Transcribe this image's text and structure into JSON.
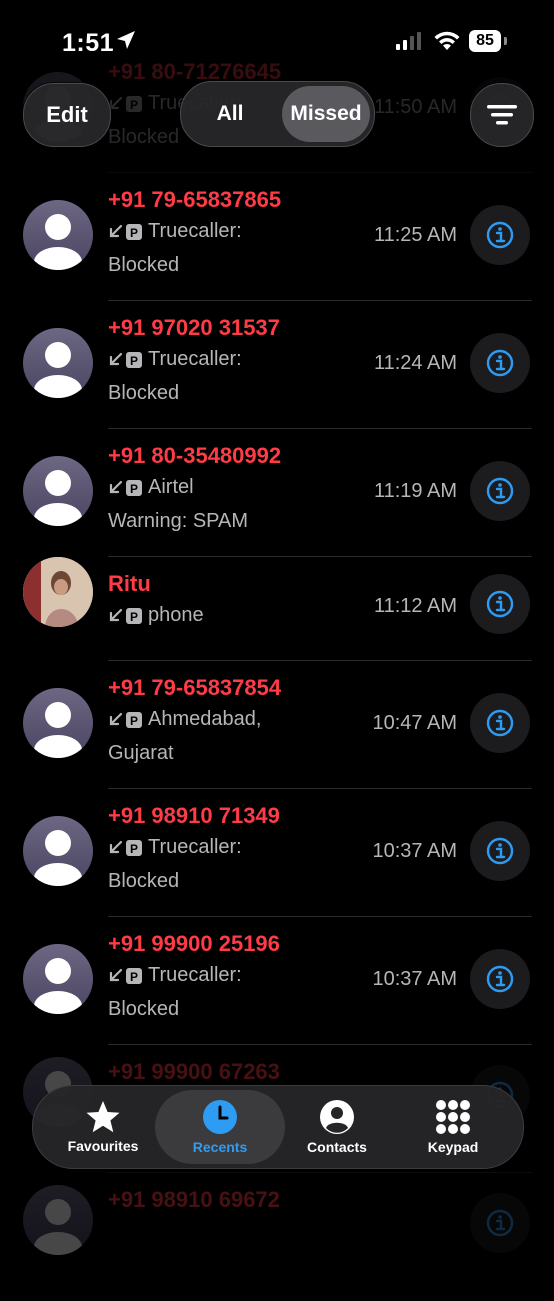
{
  "status_bar": {
    "time": "1:51",
    "battery": "85"
  },
  "toolbar": {
    "edit_label": "Edit",
    "filter_all": "All",
    "filter_missed": "Missed"
  },
  "calls": [
    {
      "name": "+91 80-71276645",
      "line1": "Truecaller:",
      "line2": "Blocked",
      "time": "11:50 AM",
      "photo": false
    },
    {
      "name": "+91 79-65837865",
      "line1": "Truecaller:",
      "line2": "Blocked",
      "time": "11:25 AM",
      "photo": false
    },
    {
      "name": "+91 97020 31537",
      "line1": "Truecaller:",
      "line2": "Blocked",
      "time": "11:24 AM",
      "photo": false
    },
    {
      "name": "+91 80-35480992",
      "line1": "Airtel",
      "line2": "Warning: SPAM",
      "time": "11:19 AM",
      "photo": false
    },
    {
      "name": "Ritu",
      "line1": "phone",
      "line2": "",
      "time": "11:12 AM",
      "photo": true
    },
    {
      "name": "+91 79-65837854",
      "line1": "Ahmedabad,",
      "line2": "Gujarat",
      "time": "10:47 AM",
      "photo": false
    },
    {
      "name": "+91 98910 71349",
      "line1": "Truecaller:",
      "line2": "Blocked",
      "time": "10:37 AM",
      "photo": false
    },
    {
      "name": "+91 99900 25196",
      "line1": "Truecaller:",
      "line2": "Blocked",
      "time": "10:37 AM",
      "photo": false
    },
    {
      "name": "+91 99900 67263",
      "line1": "",
      "line2": "",
      "time": "",
      "photo": false
    },
    {
      "name": "+91 98910 69672",
      "line1": "",
      "line2": "",
      "time": "",
      "photo": false
    }
  ],
  "tabs": [
    {
      "label": "Favourites",
      "icon": "star-icon",
      "active": false
    },
    {
      "label": "Recents",
      "icon": "clock-icon",
      "active": true
    },
    {
      "label": "Contacts",
      "icon": "person-circle-icon",
      "active": false
    },
    {
      "label": "Keypad",
      "icon": "keypad-icon",
      "active": false
    }
  ],
  "colors": {
    "missed_call_red": "#ff3b46",
    "accent_blue": "#2f9cf4",
    "background": "#000000"
  }
}
